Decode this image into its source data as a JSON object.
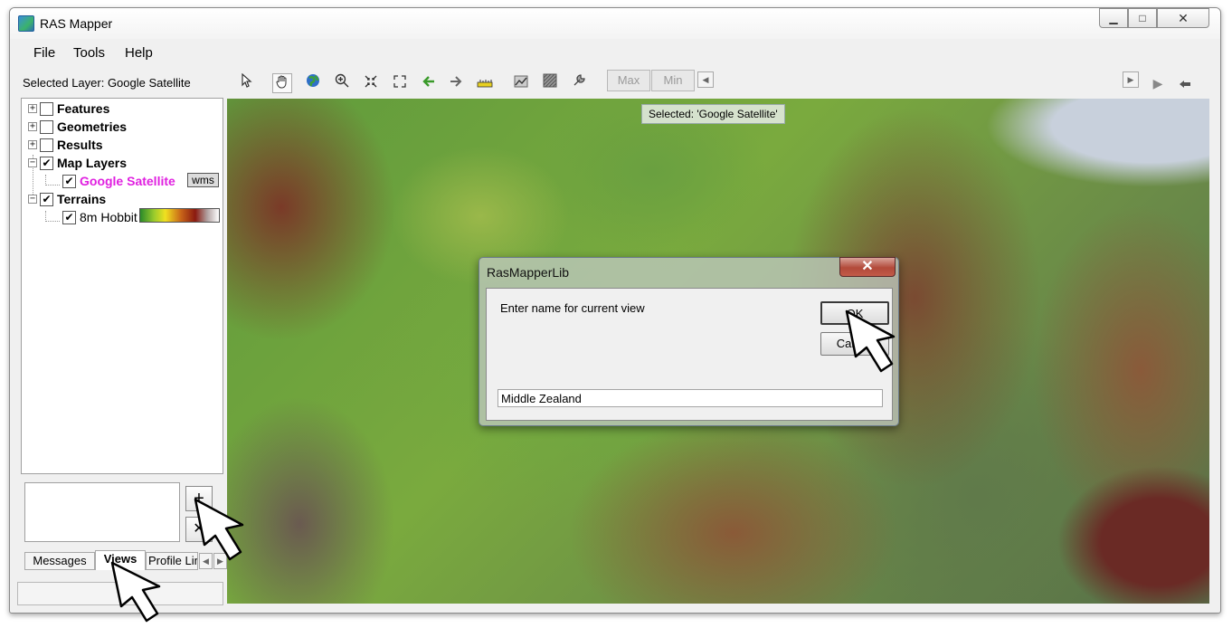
{
  "window": {
    "title": "RAS Mapper",
    "min_glyph": "▁",
    "max_glyph": "□",
    "close_glyph": "✕"
  },
  "menu": [
    "File",
    "Tools",
    "Help"
  ],
  "selected_layer": "Selected Layer: Google Satellite",
  "toolbar": {
    "max_label": "Max",
    "min_label": "Min"
  },
  "tree": {
    "features": "Features",
    "geometries": "Geometries",
    "results": "Results",
    "map_layers": "Map Layers",
    "google_satellite": "Google Satellite",
    "wms": "wms",
    "terrains": "Terrains",
    "terrain_item": "8m Hobbit"
  },
  "views_panel": {
    "add_glyph": "+",
    "remove_glyph": "✕"
  },
  "tabs": [
    "Messages",
    "Views",
    "Profile Lin"
  ],
  "map": {
    "selected_label": "Selected: 'Google Satellite'"
  },
  "dialog": {
    "title": "RasMapperLib",
    "prompt": "Enter name for current view",
    "ok_label": "OK",
    "cancel_label": "Cancel",
    "name_value": "Middle Zealand",
    "close_glyph": "✕"
  },
  "colors": {
    "highlight_layer": "#e020e0",
    "dialog_close": "#c25a48"
  }
}
